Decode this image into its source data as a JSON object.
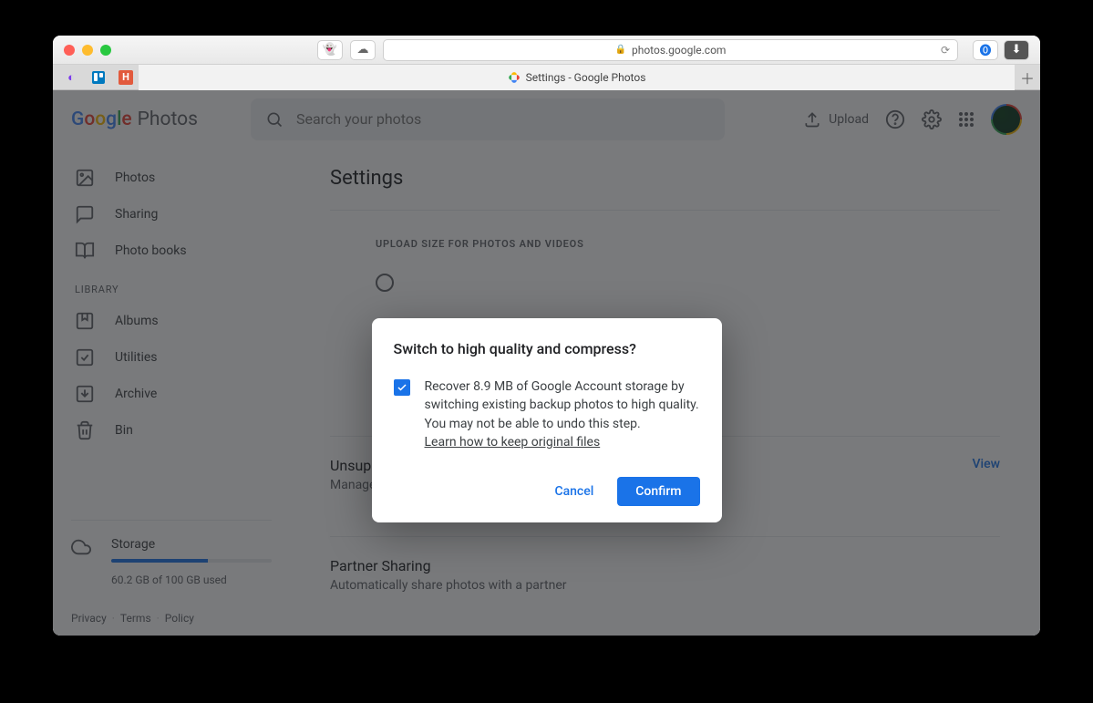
{
  "browser": {
    "url": "photos.google.com",
    "tab_title": "Settings - Google Photos"
  },
  "header": {
    "logo_product": "Photos",
    "search_placeholder": "Search your photos",
    "upload_label": "Upload"
  },
  "sidebar": {
    "items": [
      {
        "label": "Photos",
        "icon": "image-icon"
      },
      {
        "label": "Sharing",
        "icon": "chat-icon"
      },
      {
        "label": "Photo books",
        "icon": "book-icon"
      }
    ],
    "library_label": "LIBRARY",
    "library_items": [
      {
        "label": "Albums",
        "icon": "bookmark-icon"
      },
      {
        "label": "Utilities",
        "icon": "check-square-icon"
      },
      {
        "label": "Archive",
        "icon": "archive-icon"
      },
      {
        "label": "Bin",
        "icon": "trash-icon"
      }
    ],
    "storage": {
      "title": "Storage",
      "used_text": "60.2 GB of 100 GB used",
      "used_pct": 60
    },
    "footer": {
      "privacy": "Privacy",
      "terms": "Terms",
      "policy": "Policy"
    }
  },
  "main": {
    "title": "Settings",
    "upload_section_title": "UPLOAD SIZE FOR PHOTOS AND VIDEOS",
    "unsupported": {
      "title": "Unsupported videos",
      "desc": "Manage your videos that can't be processed",
      "action": "View"
    },
    "partner": {
      "title": "Partner Sharing",
      "desc": "Automatically share photos with a partner"
    }
  },
  "dialog": {
    "title": "Switch to high quality and compress?",
    "body": "Recover 8.9 MB of Google Account storage by switching existing backup photos to high quality. You may not be able to undo this step.",
    "link": "Learn how to keep original files",
    "cancel": "Cancel",
    "confirm": "Confirm",
    "checked": true
  }
}
